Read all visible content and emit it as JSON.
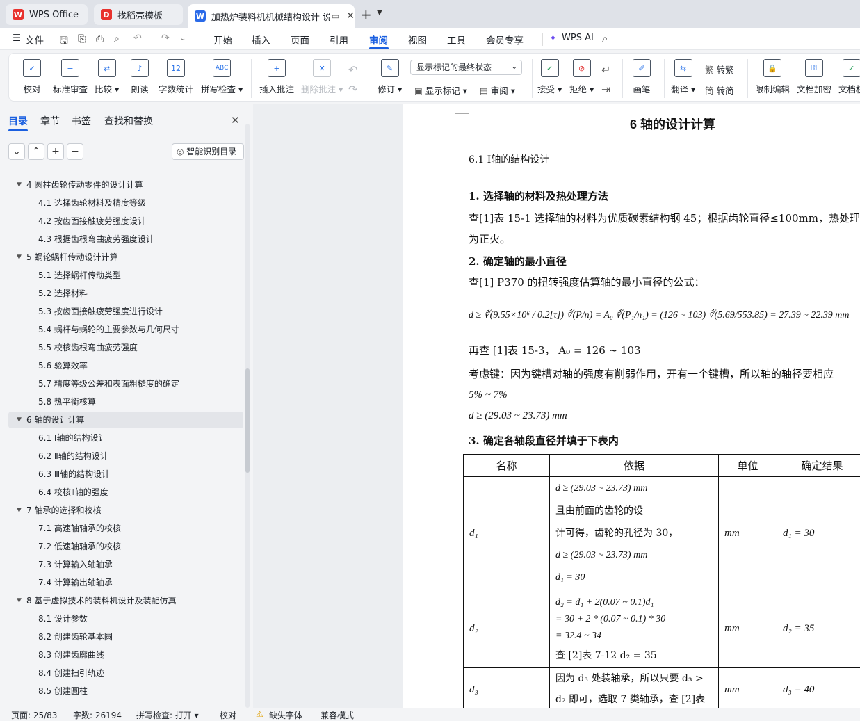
{
  "tabs": [
    {
      "label": "WPS Office",
      "icon": "wps-logo-icon"
    },
    {
      "label": "找稻壳模板",
      "icon": "docer-icon"
    },
    {
      "label": "加热炉装料机机械结构设计 说",
      "icon": "word-doc-icon"
    }
  ],
  "menu": {
    "file": "文件",
    "items": [
      "开始",
      "插入",
      "页面",
      "引用",
      "审阅",
      "视图",
      "工具",
      "会员专享"
    ],
    "selected": "审阅",
    "ai": "WPS AI"
  },
  "ribbon": {
    "buttons": [
      {
        "label": "校对"
      },
      {
        "label": "标准审查"
      },
      {
        "label": "比较 ▾"
      },
      {
        "label": "朗读"
      },
      {
        "label": "字数统计"
      },
      {
        "label": "拼写检查 ▾"
      },
      {
        "label": "插入批注"
      },
      {
        "label": "删除批注 ▾"
      },
      {
        "label": "修订 ▾"
      },
      {
        "label": "接受 ▾"
      },
      {
        "label": "拒绝 ▾"
      },
      {
        "label": "画笔"
      },
      {
        "label": "翻译 ▾"
      },
      {
        "label": "限制编辑"
      },
      {
        "label": "文档加密"
      },
      {
        "label": "文档权"
      }
    ],
    "markup_select": "显示标记的最终状态",
    "show_markup": "显示标记 ▾",
    "review": "审阅 ▾",
    "to_traditional": "转繁",
    "to_simplified": "转简"
  },
  "sidebar": {
    "tabs": [
      "目录",
      "章节",
      "书签",
      "查找和替换"
    ],
    "smart_toc": "智能识别目录",
    "toc": [
      {
        "text": "4   圆柱齿轮传动零件的设计计算",
        "level": 1
      },
      {
        "text": "4.1  选择齿轮材料及精度等级",
        "level": 2
      },
      {
        "text": "4.2 按齿面接触疲劳强度设计",
        "level": 2
      },
      {
        "text": "4.3  根据齿根弯曲疲劳强度设计",
        "level": 2
      },
      {
        "text": "5   蜗轮蜗杆传动设计计算",
        "level": 1
      },
      {
        "text": "5.1  选择蜗杆传动类型",
        "level": 2
      },
      {
        "text": "5.2  选择材料",
        "level": 2
      },
      {
        "text": "5.3  按齿面接触疲劳强度进行设计",
        "level": 2
      },
      {
        "text": "5.4  蜗杆与蜗轮的主要参数与几何尺寸",
        "level": 2
      },
      {
        "text": "5.5  校核齿根弯曲疲劳强度",
        "level": 2
      },
      {
        "text": "5.6  验算效率",
        "level": 2
      },
      {
        "text": "5.7  精度等级公差和表面粗糙度的确定",
        "level": 2
      },
      {
        "text": "5.8  热平衡核算",
        "level": 2
      },
      {
        "text": "6   轴的设计计算",
        "level": 1
      },
      {
        "text": "6.1  Ⅰ轴的结构设计",
        "level": 2
      },
      {
        "text": "6.2  Ⅱ轴的结构设计",
        "level": 2
      },
      {
        "text": "6.3  Ⅲ轴的结构设计",
        "level": 2
      },
      {
        "text": "6.4  校核Ⅱ轴的强度",
        "level": 2
      },
      {
        "text": "7   轴承的选择和校核",
        "level": 1
      },
      {
        "text": "7.1  高速轴轴承的校核",
        "level": 2
      },
      {
        "text": "7.2  低速轴轴承的校核",
        "level": 2
      },
      {
        "text": "7.3  计算输入轴轴承",
        "level": 2
      },
      {
        "text": "7.4  计算输出轴轴承",
        "level": 2
      },
      {
        "text": "8   基于虚拟技术的装料机设计及装配仿真",
        "level": 1
      },
      {
        "text": "8.1 设计参数",
        "level": 2
      },
      {
        "text": "8.2 创建齿轮基本圆",
        "level": 2
      },
      {
        "text": "8.3 创建齿廓曲线",
        "level": 2
      },
      {
        "text": "8.4 创建扫引轨迹",
        "level": 2
      },
      {
        "text": "8.5 创建圆柱",
        "level": 2
      }
    ]
  },
  "doc": {
    "heading_marker": "H1",
    "chapter_title": "6   轴的设计计算",
    "section": "6.1  Ⅰ轴的结构设计",
    "sub1": "1.  选择轴的材料及热处理方法",
    "p1": "查[1]表 15-1 选择轴的材料为优质碳素结构钢 45；根据齿轮直径≤100mm，热处理",
    "p1b": "为正火。",
    "sub2": "2.  确定轴的最小直径",
    "p2": "查[1] P370 的扭转强度估算轴的最小直径的公式：",
    "formula": "d ≥ ∛(9.55×10⁶ / 0.2[τ]) ∛(P/n) = A₀ ∛(P₁/n₁) = (126 ~ 103) ∛(5.69/553.85) = 27.39 ~ 22.39 mm",
    "p3": "再查 [1]表 15-3，  A₀ = 126 ~ 103",
    "p4": "考虑键：因为键槽对轴的强度有削弱作用，开有一个键槽，所以轴的轴径要相应",
    "p5": "5% ~ 7%",
    "p6": "d ≥ (29.03 ~ 23.73) mm",
    "sub3": "3.  确定各轴段直径并填于下表内",
    "table": {
      "headers": [
        "名称",
        "依据",
        "单位",
        "确定结果"
      ],
      "rows": [
        {
          "name": "d₁",
          "basis": [
            "d ≥ (29.03 ~ 23.73) mm",
            "且由前面的齿轮的设",
            "计可得，齿轮的孔径为 30，",
            "d ≥ (29.03 ~ 23.73) mm",
            "d₁ = 30"
          ],
          "unit": "mm",
          "result": "d₁ = 30"
        },
        {
          "name": "d₂",
          "basis": [
            "d₂ = d₁ + 2(0.07 ~ 0.1)d₁",
            "= 30 + 2 * (0.07 ~ 0.1) * 30",
            "= 32.4 ~ 34",
            "查 [2]表 7-12    d₂ = 35"
          ],
          "unit": "mm",
          "result": "d₂ = 35"
        },
        {
          "name": "d₃",
          "basis": [
            "因为 d₃ 处装轴承，所以只要 d₃ >",
            "d₂ 即可，选取 7 类轴承，查 [2]表"
          ],
          "unit": "mm",
          "result": "d₃ = 40"
        }
      ]
    }
  },
  "status": {
    "page": "页面: 25/83",
    "words": "字数: 26194",
    "spell": "拼写检查: 打开 ▾",
    "proof": "校对",
    "missing_font": "缺失字体",
    "compat": "兼容模式"
  }
}
